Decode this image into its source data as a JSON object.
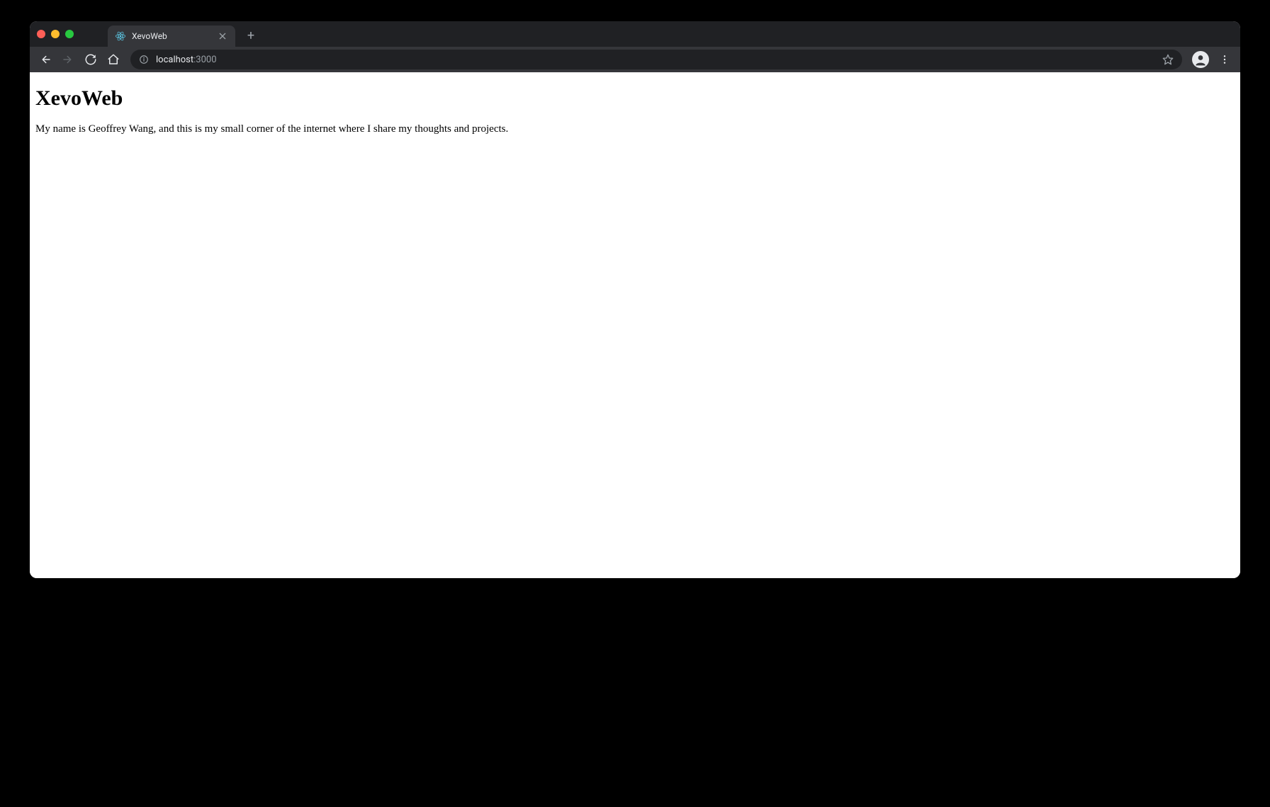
{
  "browser": {
    "tab": {
      "title": "XevoWeb"
    },
    "address": {
      "host": "localhost",
      "port": ":3000"
    }
  },
  "page": {
    "heading": "XevoWeb",
    "intro": "My name is Geoffrey Wang, and this is my small corner of the internet where I share my thoughts and projects."
  }
}
